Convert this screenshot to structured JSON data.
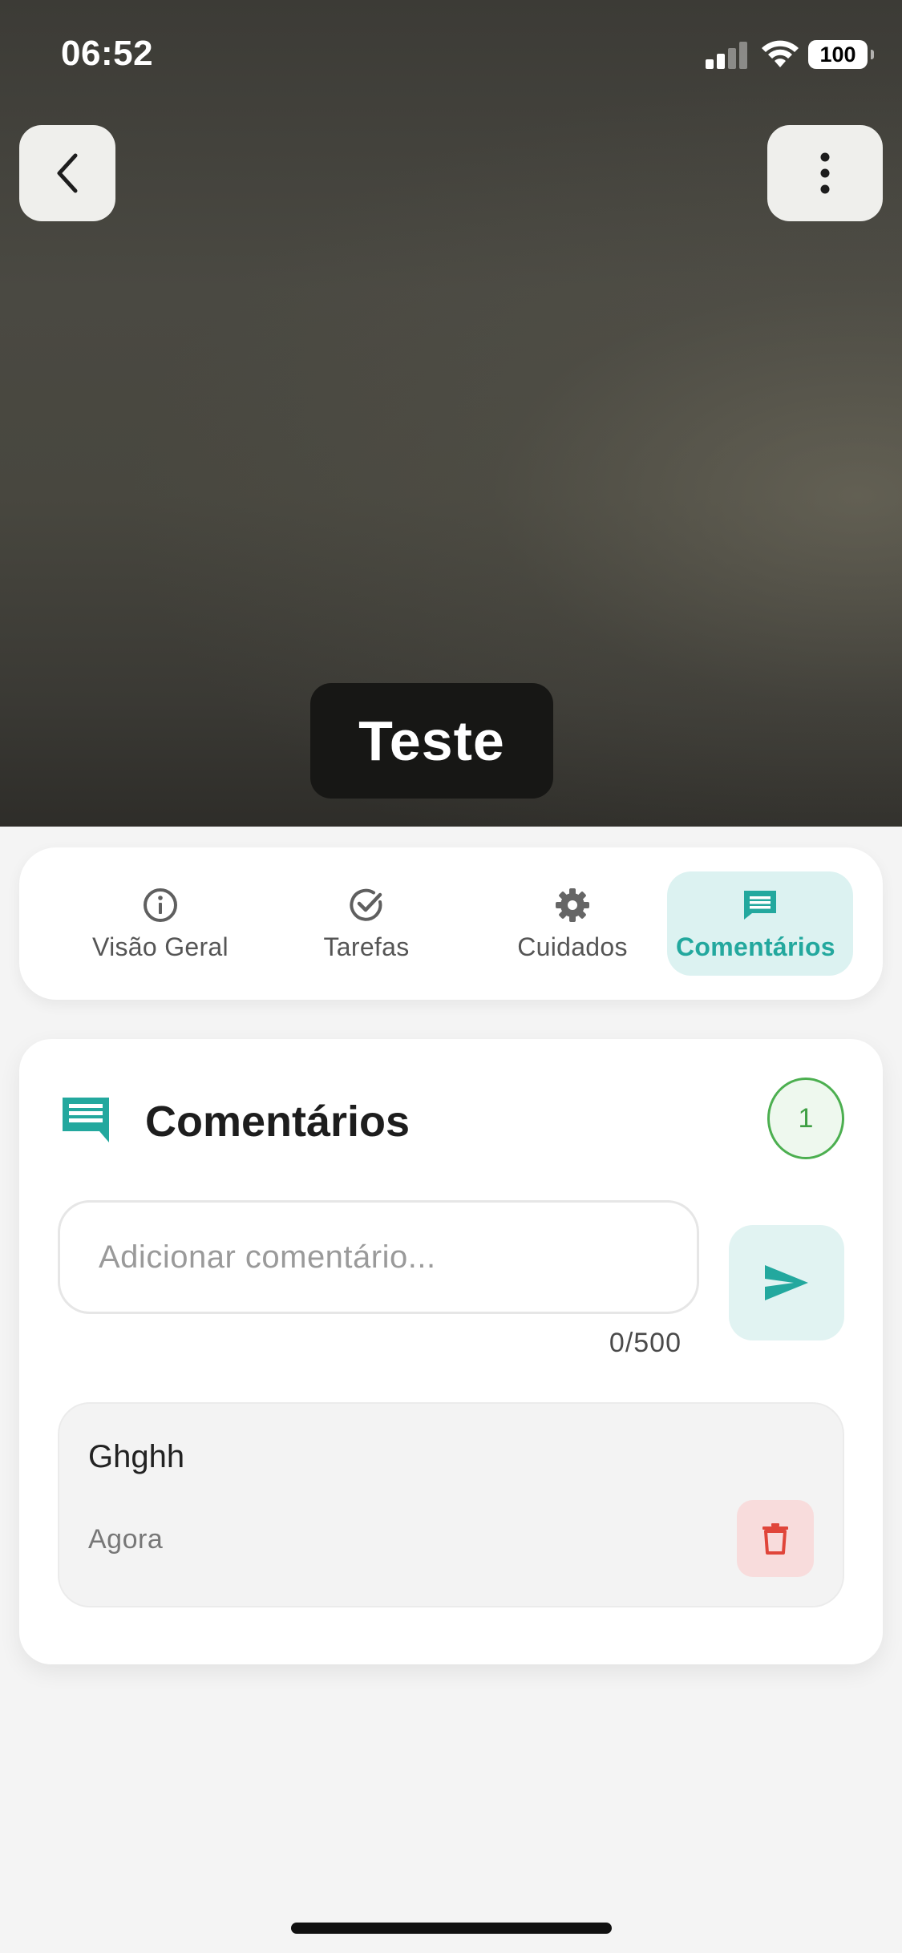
{
  "status_bar": {
    "time": "06:52",
    "battery": "100",
    "icons": [
      "signal-icon",
      "wifi-icon",
      "battery-icon"
    ]
  },
  "header": {
    "back_icon": "chevron-left-icon",
    "menu_icon": "more-vertical-icon",
    "title": "Teste"
  },
  "tabs": [
    {
      "label": "Visão Geral",
      "icon": "info-icon",
      "active": false
    },
    {
      "label": "Tarefas",
      "icon": "check-circle-icon",
      "active": false
    },
    {
      "label": "Cuidados",
      "icon": "gear-icon",
      "active": false
    },
    {
      "label": "Comentários",
      "icon": "comment-icon",
      "active": true
    }
  ],
  "comments": {
    "title": "Comentários",
    "count": "1",
    "input": {
      "placeholder": "Adicionar comentário...",
      "value": ""
    },
    "char_counter": "0/500",
    "items": [
      {
        "text": "Ghghh",
        "time": "Agora"
      }
    ]
  },
  "colors": {
    "accent": "#23a89e",
    "active_tab_bg": "#dcf2f1",
    "badge_green": "#4caf50",
    "delete_red": "#e0453a",
    "delete_bg": "#f8dcdc"
  }
}
